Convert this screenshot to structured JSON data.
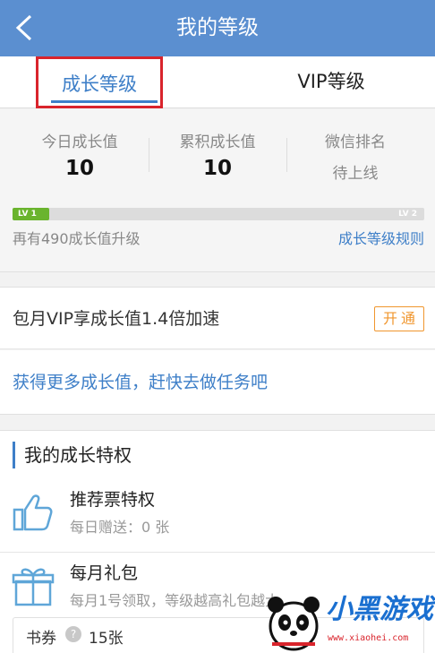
{
  "header": {
    "title": "我的等级"
  },
  "tabs": [
    {
      "label": "成长等级"
    },
    {
      "label": "VIP等级"
    }
  ],
  "stats": {
    "today": {
      "label": "今日成长值",
      "value": "10"
    },
    "total": {
      "label": "累积成长值",
      "value": "10"
    },
    "rank": {
      "label": "微信排名",
      "value": "待上线"
    }
  },
  "level": {
    "current": "LV 1",
    "next": "LV 2",
    "progress_fraction": 0.02,
    "progress_text": "再有490成长值升级",
    "rules_link": "成长等级规则"
  },
  "vip_promo": {
    "text": "包月VIP享成长值1.4倍加速",
    "button": "开通"
  },
  "task_link": "获得更多成长值，赶快去做任务吧",
  "privileges": {
    "title": "我的成长特权",
    "items": [
      {
        "name": "推荐票特权",
        "desc": "每日赠送：0 张",
        "icon": "thumbs-up-icon"
      },
      {
        "name": "每月礼包",
        "desc": "每月1号领取，等级越高礼包越大",
        "icon": "gift-icon"
      }
    ],
    "coupon": {
      "label": "书券",
      "count": "15张"
    }
  },
  "watermark": {
    "brand": "小黑游戏",
    "url": "www.xiaohei.com"
  },
  "colors": {
    "header": "#5b8fd0",
    "accent": "#3e7fc8",
    "progress": "#6ab42e",
    "button": "#f0962e",
    "highlight": "#d9242c"
  }
}
